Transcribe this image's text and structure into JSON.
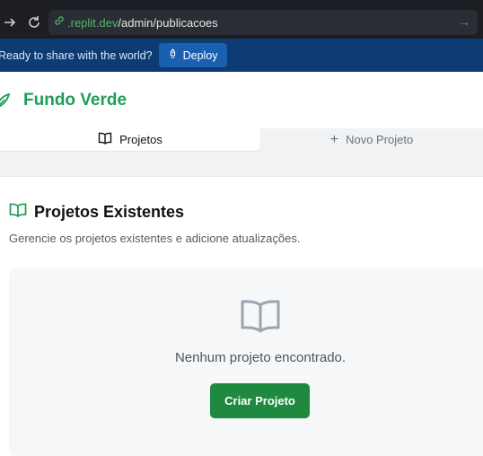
{
  "browser": {
    "url_host": ".replit.dev",
    "url_path": "/admin/publicacoes"
  },
  "deploy_bar": {
    "message": "Ready to share with the world?",
    "button_label": "Deploy"
  },
  "header": {
    "brand": "Fundo Verde"
  },
  "tabs": [
    {
      "label": "Projetos",
      "active": true
    },
    {
      "label": "Novo Projeto",
      "active": false
    }
  ],
  "section": {
    "title": "Projetos Existentes",
    "subtitle": "Gerencie os projetos existentes e adicione atualizações."
  },
  "empty_state": {
    "message": "Nenhum projeto encontrado.",
    "button_label": "Criar Projeto"
  },
  "colors": {
    "brand": "#1f9d55",
    "primary_button": "#1f8a3f",
    "deploy_bar": "#0d3b73"
  }
}
